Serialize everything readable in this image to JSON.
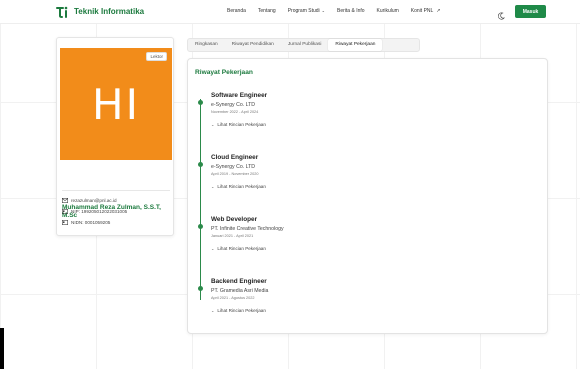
{
  "brand": {
    "name": "Teknik Informatika",
    "color": "#1c7a3e"
  },
  "nav": {
    "links": [
      {
        "label": "Beranda",
        "dropdown": false
      },
      {
        "label": "Tentang",
        "dropdown": false
      },
      {
        "label": "Program Studi",
        "dropdown": true
      },
      {
        "label": "Berita & Info",
        "dropdown": false
      },
      {
        "label": "Kurikulum",
        "dropdown": false
      },
      {
        "label": "Konit PNL",
        "dropdown": false,
        "external": true
      }
    ],
    "login_label": "Masuk",
    "accent": "#1f8a48"
  },
  "profile": {
    "initials": "HI",
    "avatar_color": "#f28c1a",
    "badge": "Lektor",
    "name": "Muhammad Reza Zulman, S.S.T, M.Sc",
    "email": "rezazulman@pnl.ac.id",
    "nip": "NIP: 199205012022031005",
    "nidn": "NIDN: 0001059205"
  },
  "tabs": [
    {
      "label": "Ringkasan",
      "active": false
    },
    {
      "label": "Riwayat Pendidikan",
      "active": false
    },
    {
      "label": "Jurnal Publikasi",
      "active": false
    },
    {
      "label": "Riwayat Pekerjaan",
      "active": true
    }
  ],
  "work": {
    "title": "Riwayat Pekerjaan",
    "more_label": "Lihat Rincian Pekerjaan",
    "jobs": [
      {
        "title": "Software Engineer",
        "company": "e-Synergy Co. LTD",
        "period": "November 2022 - April 2024"
      },
      {
        "title": "Cloud Engineer",
        "company": "e-Synergy Co. LTD",
        "period": "April 2019 - November 2020"
      },
      {
        "title": "Web Developer",
        "company": "PT. Infinite Creative Technology",
        "period": "Januari 2021 - April 2021"
      },
      {
        "title": "Backend Engineer",
        "company": "PT. Gramedia Asri Media",
        "period": "April 2021 - Agustus 2022"
      }
    ]
  }
}
